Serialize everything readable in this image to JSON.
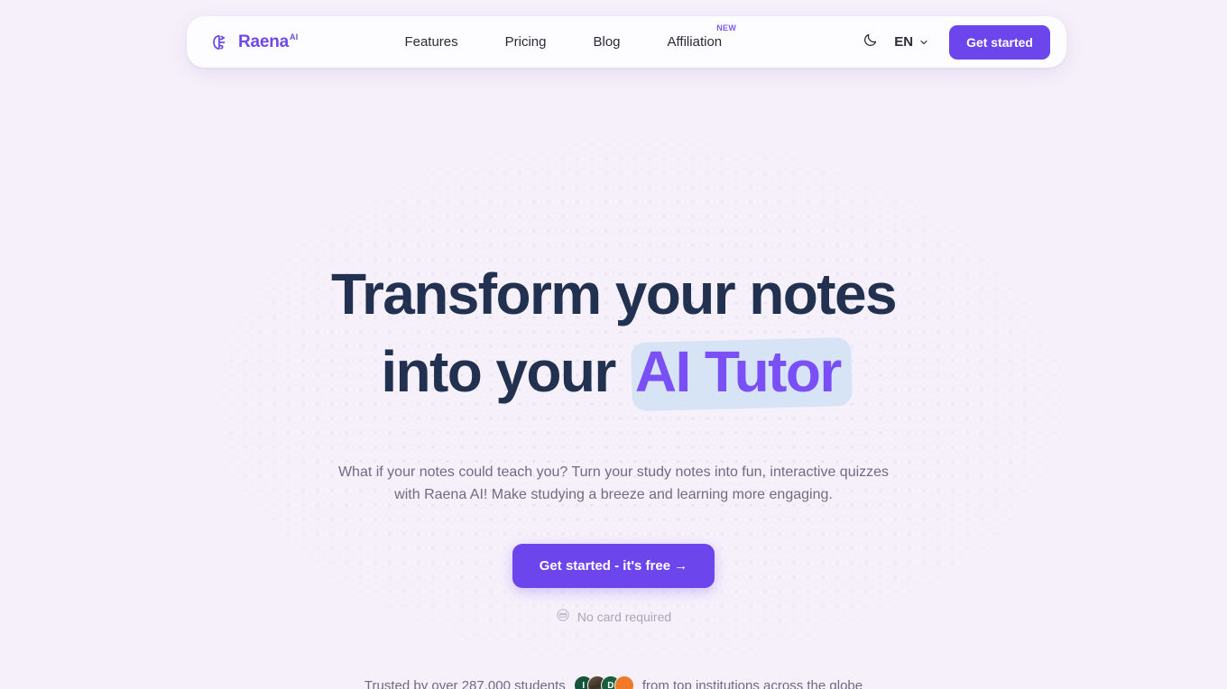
{
  "colors": {
    "page_bg": "#f6f0fb",
    "navbar_bg": "#fdfcfe",
    "brand_purple": "#6d4ae8",
    "accent_purple": "#6d45ed",
    "highlight_purple": "#7a4ff5",
    "highlight_band": "#d4e3f6",
    "heading_navy": "#22314f",
    "body_text": "#6f6b84",
    "muted_text": "#a8a5b8"
  },
  "navbar": {
    "brand": {
      "icon": "brain-icon",
      "name": "Raena",
      "superscript": "AI"
    },
    "links": [
      {
        "label": "Features",
        "badge": ""
      },
      {
        "label": "Pricing",
        "badge": ""
      },
      {
        "label": "Blog",
        "badge": ""
      },
      {
        "label": "Affiliation",
        "badge": "NEW"
      }
    ],
    "theme_toggle_icon": "moon-icon",
    "language": {
      "value": "EN",
      "chevron_icon": "chevron-down-icon"
    },
    "cta_label": "Get started"
  },
  "hero": {
    "title_line1": "Transform your notes",
    "title_line2_prefix": "into your ",
    "title_highlight": "AI Tutor",
    "subtitle": "What if your notes could teach you? Turn your study notes into fun, interactive quizzes with Raena AI! Make studying a breeze and learning more engaging.",
    "cta_label": "Get started - it's free  →",
    "no_card": {
      "icon": "card-icon",
      "label": "No card required"
    },
    "trusted": {
      "prefix": "Trusted by over 287,000 students",
      "suffix": "from top institutions across the globe",
      "avatars": [
        {
          "name": "avatar-1",
          "initial": "I",
          "bg": "#14543a"
        },
        {
          "name": "avatar-2",
          "initial": "",
          "bg": "#4a3b2c"
        },
        {
          "name": "avatar-3",
          "initial": "D",
          "bg": "#16603c"
        },
        {
          "name": "avatar-4",
          "initial": "",
          "bg": "#f07a2a"
        }
      ]
    }
  }
}
